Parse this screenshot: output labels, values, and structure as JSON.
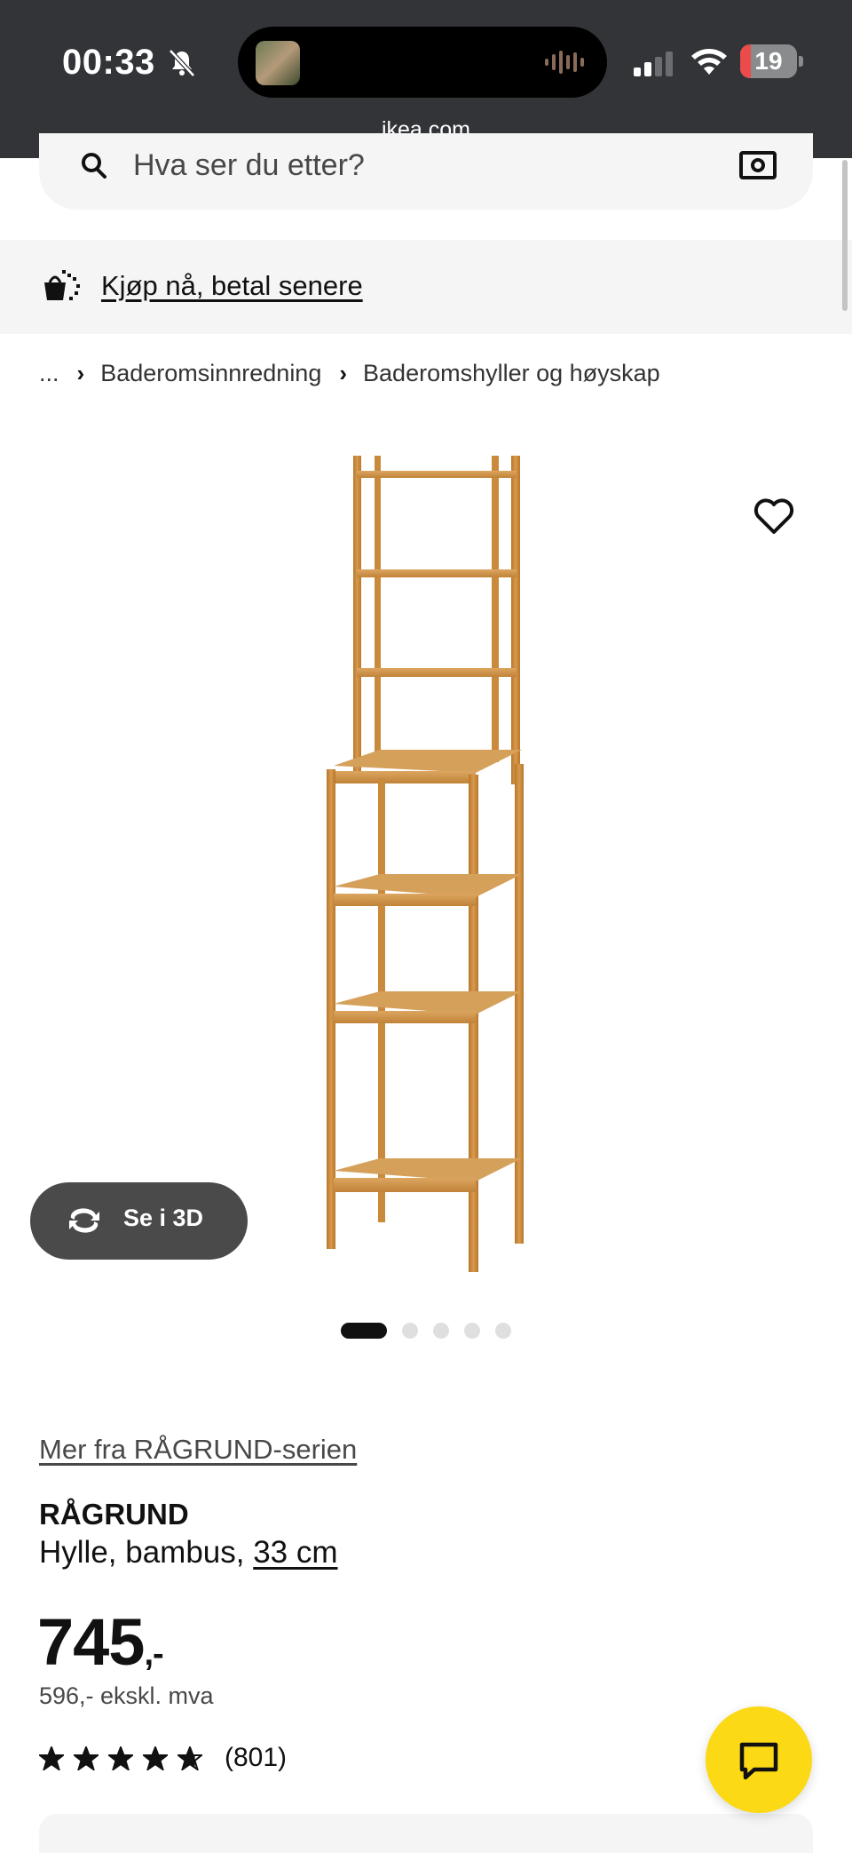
{
  "status_bar": {
    "time": "00:33",
    "battery": "19",
    "battery_level": 0.19,
    "url": "ikea.com"
  },
  "search": {
    "placeholder": "Hva ser du etter?"
  },
  "promo": {
    "link": "Kjøp nå, betal senere"
  },
  "breadcrumb": {
    "ellipsis": "...",
    "items": [
      "Baderomsinnredning",
      "Baderomshyller og høyskap"
    ]
  },
  "gallery": {
    "view_3d_label": "Se i 3D",
    "image_count": 5,
    "active_index": 0
  },
  "product": {
    "series_link": "Mer fra RÅGRUND-serien",
    "name": "RÅGRUND",
    "description": "Hylle, bambus,",
    "size": "33 cm",
    "price": "745",
    "price_suffix": ",-",
    "price_ex_vat": "596,- ekskl. mva",
    "rating_value": 4.7,
    "rating_count": "(801)"
  },
  "colors": {
    "status_bg": "#323437",
    "chat_yellow": "#fbd914",
    "bamboo": "#c98a3c",
    "battery_red": "#eb4b4b"
  },
  "icons": [
    "bell-slash-icon",
    "signal-icon",
    "wifi-icon",
    "search-icon",
    "camera-icon",
    "bag-icon",
    "heart-icon",
    "rotate-3d-icon",
    "star-icon",
    "chat-icon"
  ]
}
